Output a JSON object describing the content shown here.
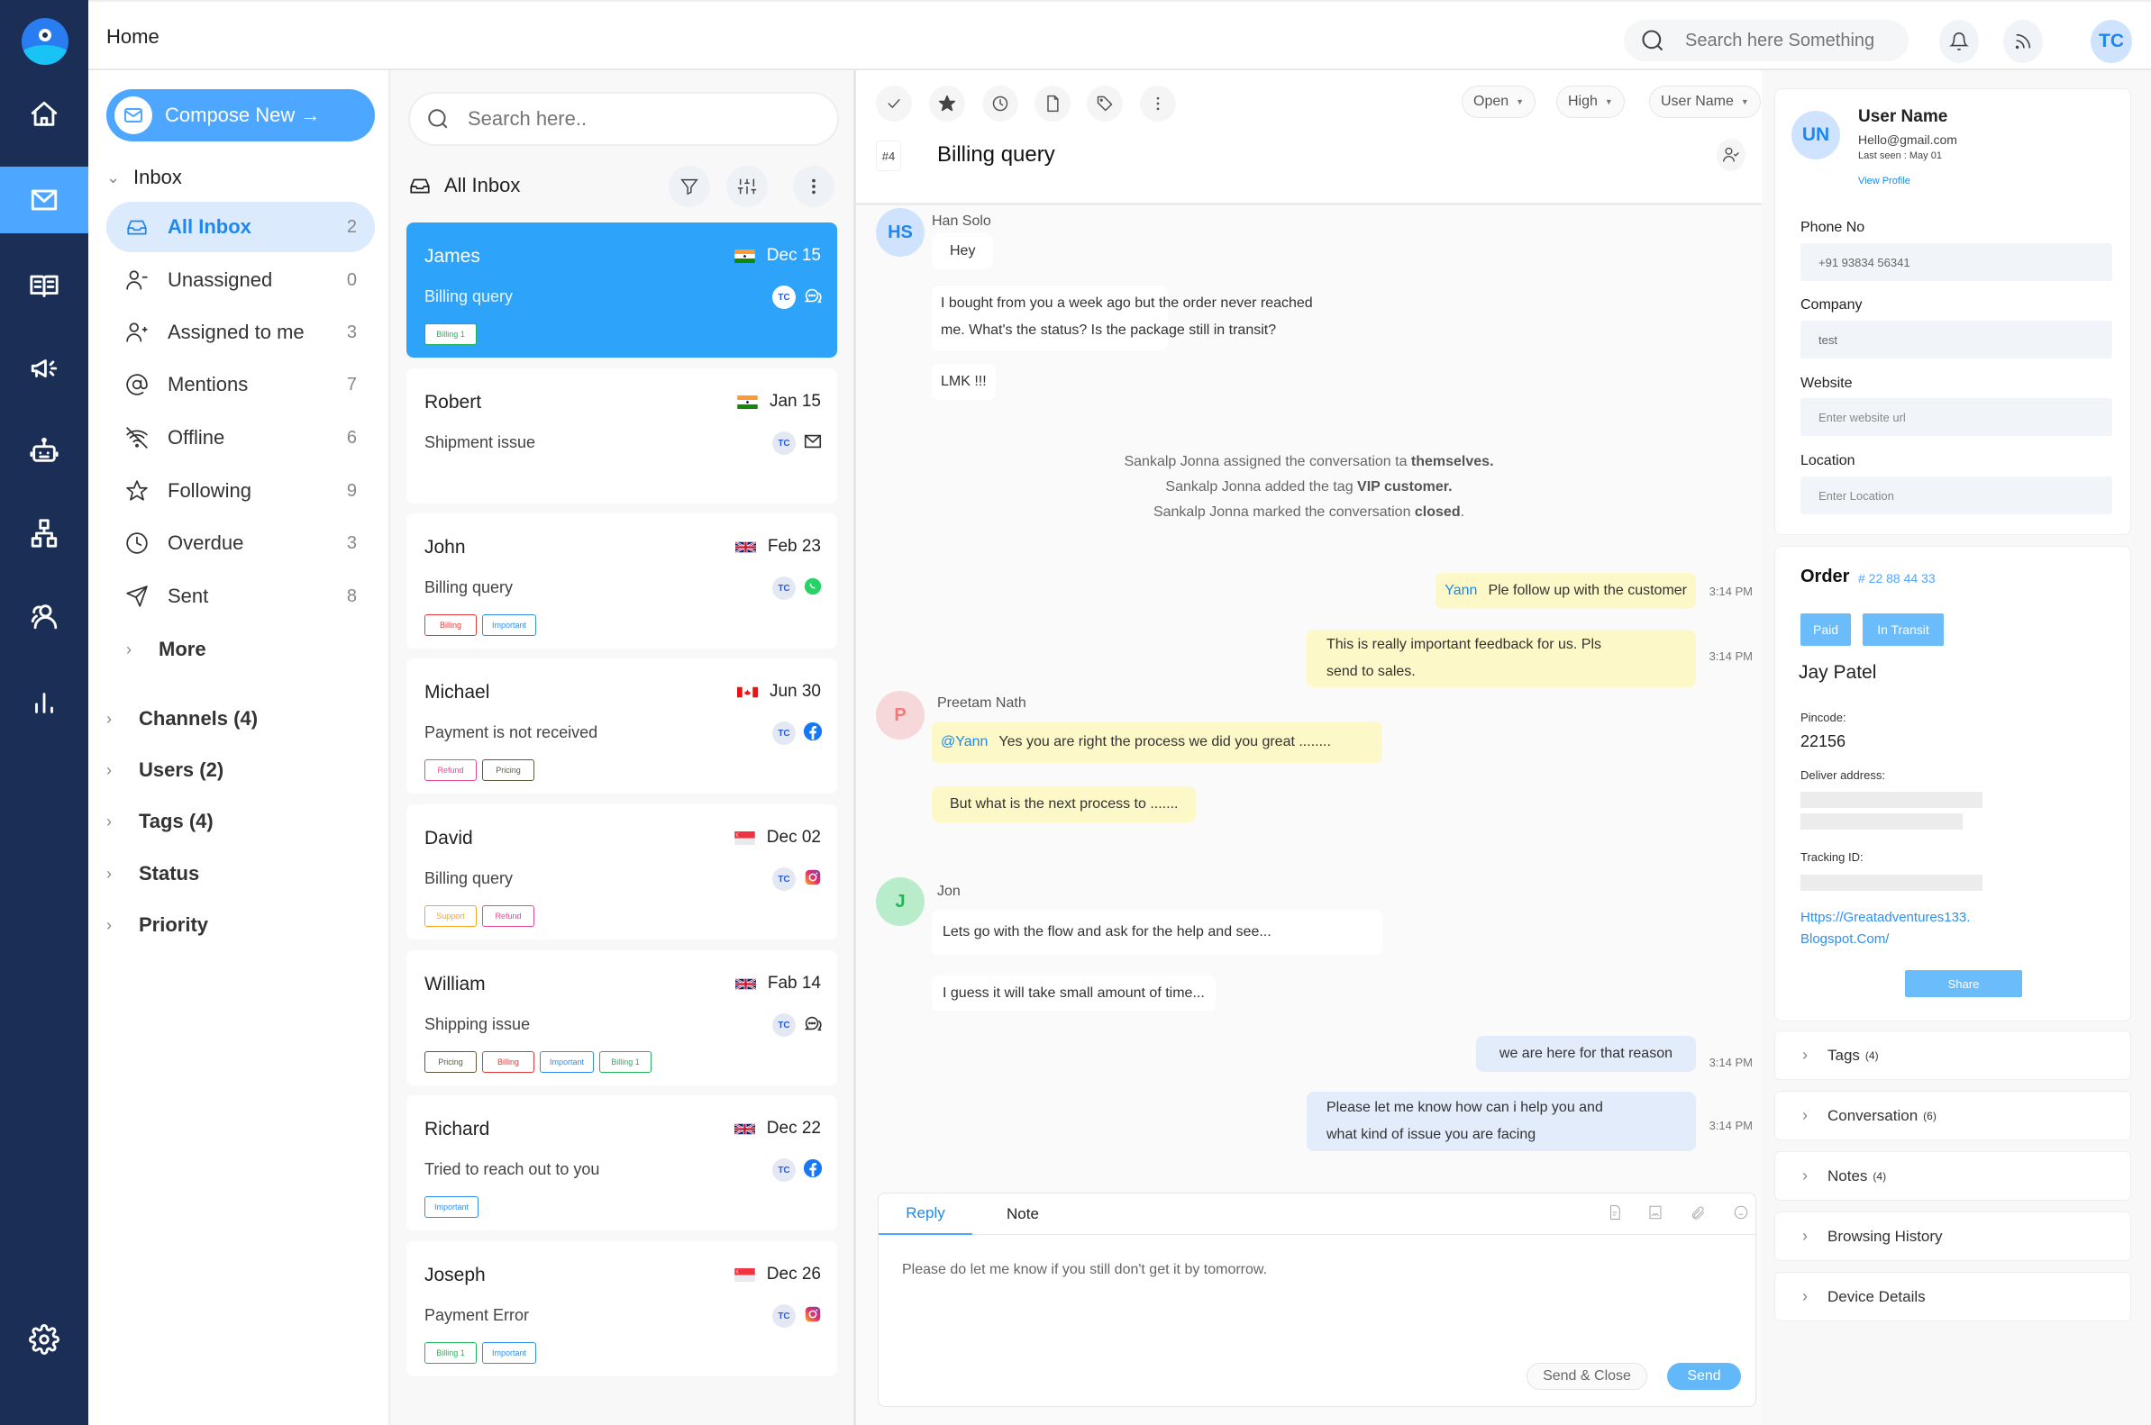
{
  "app": {
    "breadcrumb": "Home",
    "brand_color": "#4da6ff",
    "rail_color": "#1b2f56"
  },
  "rail": {
    "items": [
      {
        "icon": "home-icon",
        "active": false
      },
      {
        "icon": "mail-icon",
        "active": true
      },
      {
        "icon": "book-icon",
        "active": false
      },
      {
        "icon": "megaphone-icon",
        "active": false
      },
      {
        "icon": "bot-icon",
        "active": false
      },
      {
        "icon": "org-chart-icon",
        "active": false
      },
      {
        "icon": "users-icon",
        "active": false
      },
      {
        "icon": "bar-chart-icon",
        "active": false
      }
    ],
    "settings_icon": "gear-icon"
  },
  "topbar": {
    "search_placeholder": "Search here Something",
    "avatar_initials": "TC"
  },
  "nav": {
    "compose_label": "Compose New →",
    "inbox_label": "Inbox",
    "items": [
      {
        "label": "All Inbox",
        "count": "2",
        "icon": "inbox-icon",
        "active": true
      },
      {
        "label": "Unassigned",
        "count": "0",
        "icon": "user-minus-icon"
      },
      {
        "label": "Assigned to me",
        "count": "3",
        "icon": "user-plus-icon"
      },
      {
        "label": "Mentions",
        "count": "7",
        "icon": "at-icon"
      },
      {
        "label": "Offline",
        "count": "6",
        "icon": "wifi-off-icon"
      },
      {
        "label": "Following",
        "count": "9",
        "icon": "star-icon"
      },
      {
        "label": "Overdue",
        "count": "3",
        "icon": "clock-icon"
      },
      {
        "label": "Sent",
        "count": "8",
        "icon": "send-icon"
      }
    ],
    "more_label": "More",
    "groups": [
      {
        "label": "Channels (4)"
      },
      {
        "label": "Users (2)"
      },
      {
        "label": "Tags (4)"
      },
      {
        "label": "Status"
      },
      {
        "label": "Priority"
      }
    ]
  },
  "list": {
    "search_placeholder": "Search here..",
    "title": "All Inbox",
    "conversations": [
      {
        "name": "James",
        "date": "Dec 15",
        "flag": "india",
        "subject": "Billing query",
        "agent": "TC",
        "channel": "chat",
        "selected": true,
        "tags": [
          {
            "label": "Billing 1",
            "color": "#22b45a"
          }
        ]
      },
      {
        "name": "Robert",
        "date": "Jan 15",
        "flag": "india",
        "subject": "Shipment issue",
        "agent": "TC",
        "channel": "email",
        "tags": []
      },
      {
        "name": "John",
        "date": "Feb 23",
        "flag": "uk",
        "subject": "Billing query",
        "agent": "TC",
        "channel": "whatsapp",
        "tags": [
          {
            "label": "Billing",
            "color": "#e53935"
          },
          {
            "label": "Important",
            "color": "#2f8ff0"
          }
        ]
      },
      {
        "name": "Michael",
        "date": "Jun 30",
        "flag": "canada",
        "subject": "Payment is not received",
        "agent": "TC",
        "channel": "facebook",
        "tags": [
          {
            "label": "Refund",
            "color": "#e84a8f"
          },
          {
            "label": "Pricing",
            "color": "#5e5a3e"
          }
        ]
      },
      {
        "name": "David",
        "date": "Dec 02",
        "flag": "singapore",
        "subject": "Billing query",
        "agent": "TC",
        "channel": "instagram",
        "tags": [
          {
            "label": "Support",
            "color": "#f5a623"
          },
          {
            "label": "Refund",
            "color": "#e84a8f"
          }
        ]
      },
      {
        "name": "William",
        "date": "Fab 14",
        "flag": "uk",
        "subject": "Shipping issue",
        "agent": "TC",
        "channel": "chat",
        "tags": [
          {
            "label": "Pricing",
            "color": "#5e5a3e"
          },
          {
            "label": "Billing",
            "color": "#e53935"
          },
          {
            "label": "Important",
            "color": "#2f8ff0"
          },
          {
            "label": "Billing 1",
            "color": "#22b45a"
          }
        ]
      },
      {
        "name": "Richard",
        "date": "Dec 22",
        "flag": "uk",
        "subject": "Tried to reach out to you",
        "agent": "TC",
        "channel": "facebook",
        "tags": [
          {
            "label": "Important",
            "color": "#2f8ff0"
          }
        ]
      },
      {
        "name": "Joseph",
        "date": "Dec 26",
        "flag": "singapore",
        "subject": "Payment Error",
        "agent": "TC",
        "channel": "instagram",
        "tags": [
          {
            "label": "Billing 1",
            "color": "#22b45a"
          },
          {
            "label": "Important",
            "color": "#2f8ff0"
          }
        ]
      }
    ]
  },
  "chat": {
    "toolbar_icons": [
      "check-icon",
      "star-icon",
      "clock-icon",
      "file-icon",
      "tag-icon",
      "more-icon"
    ],
    "status": "Open",
    "priority": "High",
    "assignee": "User Name",
    "ticket_number": "#4",
    "title": "Billing query",
    "messages": {
      "m1_sender": "Han Solo",
      "m1_initials": "HS",
      "m1_text": "Hey",
      "m2_line1": "I bought from you a week ago but the order never reached",
      "m2_line2": "me. What's the status? Is the package still in transit?",
      "m3_text": "LMK !!!",
      "sys1_pre": "Sankalp Jonna assigned the conversation ta ",
      "sys1_bold": "themselves.",
      "sys2_pre": "Sankalp Jonna added the tag ",
      "sys2_bold": "VIP customer.",
      "sys3_pre": "Sankalp Jonna marked the conversation ",
      "sys3_bold": "closed",
      "sys3_end": ".",
      "n1_mention": "Yann",
      "n1_text": "Ple follow up with the customer",
      "n1_time": "3:14 PM",
      "n2_line1": "This is really important feedback for us. Pls",
      "n2_line2": "send to sales.",
      "n2_time": "3:14 PM",
      "p_sender": "Preetam Nath",
      "p_initials": "P",
      "p1_mention": "@Yann",
      "p1_text": "Yes you are right the process we did you great ........",
      "p2_text": "But what is the next process to .......",
      "j_sender": "Jon",
      "j_initials": "J",
      "j1_text": "Lets go with the flow and ask for the help and see...",
      "j2_text": "I guess it will take small amount of time...",
      "o1_text": "we are here for that reason",
      "o1_time": "3:14 PM",
      "o2_line1": "Please let me know how can i help you and",
      "o2_line2": "what kind of issue you are facing",
      "o2_time": "3:14 PM"
    },
    "reply": {
      "tab_reply": "Reply",
      "tab_note": "Note",
      "text": "Please do let me know if you still don't get it by tomorrow.",
      "send_close": "Send & Close",
      "send": "Send"
    }
  },
  "contact": {
    "initials": "UN",
    "name": "User Name",
    "email": "Hello@gmail.com",
    "last_seen": "Last seen : May 01",
    "view_profile": "View Profile",
    "phone_label": "Phone No",
    "phone_value": "+91 93834 56341",
    "company_label": "Company",
    "company_value": "test",
    "website_label": "Website",
    "website_placeholder": "Enter website url",
    "location_label": "Location",
    "location_placeholder": "Enter Location"
  },
  "order": {
    "label": "Order",
    "number": "# 22 88 44 33",
    "badges": [
      "Paid",
      "In Transit"
    ],
    "customer": "Jay Patel",
    "pincode_label": "Pincode:",
    "pincode": "22156",
    "address_label": "Deliver address:",
    "tracking_label": "Tracking ID:",
    "link_line1": "Https://Greatadventures133.",
    "link_line2": "Blogspot.Com/",
    "share": "Share"
  },
  "accordions": [
    {
      "label": "Tags",
      "count": "(4)"
    },
    {
      "label": "Conversation",
      "count": "(6)"
    },
    {
      "label": "Notes",
      "count": "(4)"
    },
    {
      "label": "Browsing History",
      "count": ""
    },
    {
      "label": "Device Details",
      "count": ""
    }
  ]
}
